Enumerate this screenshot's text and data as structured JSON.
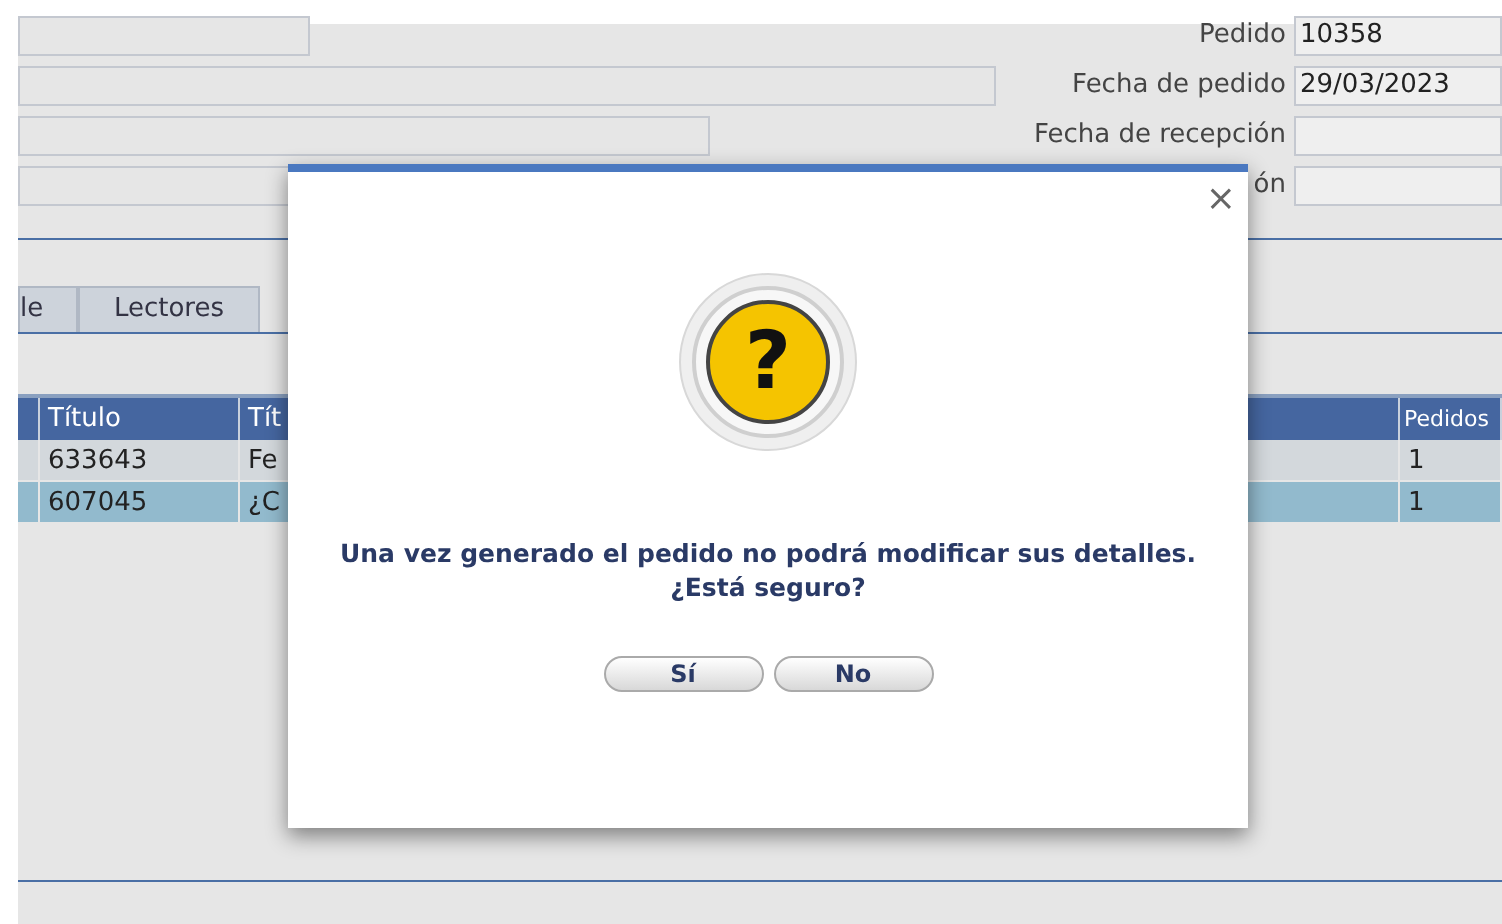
{
  "form": {
    "fields": [
      {
        "label": "Pedido",
        "value": "10358"
      },
      {
        "label": "Fecha de pedido",
        "value": "29/03/2023"
      },
      {
        "label": "Fecha de recepción"
      },
      {
        "label": "ón"
      }
    ]
  },
  "tabs": [
    {
      "label": "le",
      "selected": false
    },
    {
      "label": "Lectores",
      "selected": false
    }
  ],
  "table": {
    "columns": [
      "Título",
      "Tít",
      "Pedidos"
    ],
    "rows": [
      {
        "cells": [
          "633643",
          "Fe",
          "1"
        ],
        "selected": false
      },
      {
        "cells": [
          "607045",
          "¿C",
          "1"
        ],
        "selected": true
      }
    ]
  },
  "dialog": {
    "close": "×",
    "icon_glyph": "?",
    "message": "Una vez generado el pedido no podrá modificar sus detalles.",
    "question": "¿Está seguro?",
    "buttons": [
      "Sí",
      "No"
    ]
  }
}
